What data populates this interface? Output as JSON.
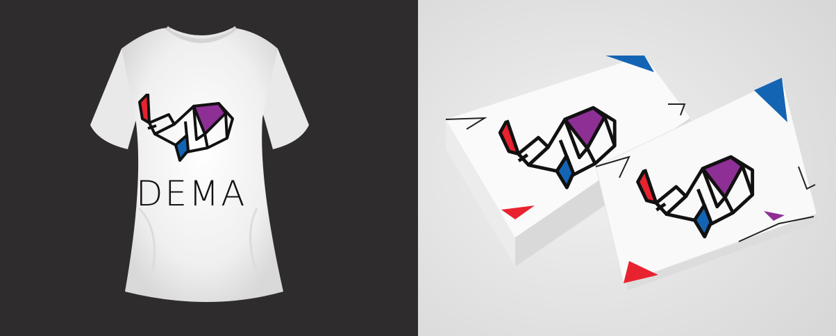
{
  "brand": {
    "name": "DEMA",
    "logo_icon": "origami-whale-icon"
  },
  "mockups": [
    {
      "subject": "t-shirt",
      "shirt_color": "white",
      "background": "dark-charcoal"
    },
    {
      "subject": "business-cards",
      "card_color": "white",
      "background": "light-gray"
    }
  ],
  "colors": {
    "left_background": "#2f2c2d",
    "right_background": "#e6e6e6",
    "shirt": "#f2f2f2",
    "card": "#f7f7f7",
    "outline": "#111111",
    "accent_red": "#e8222e",
    "accent_blue": "#1464b4",
    "accent_purple": "#8e2f96"
  }
}
